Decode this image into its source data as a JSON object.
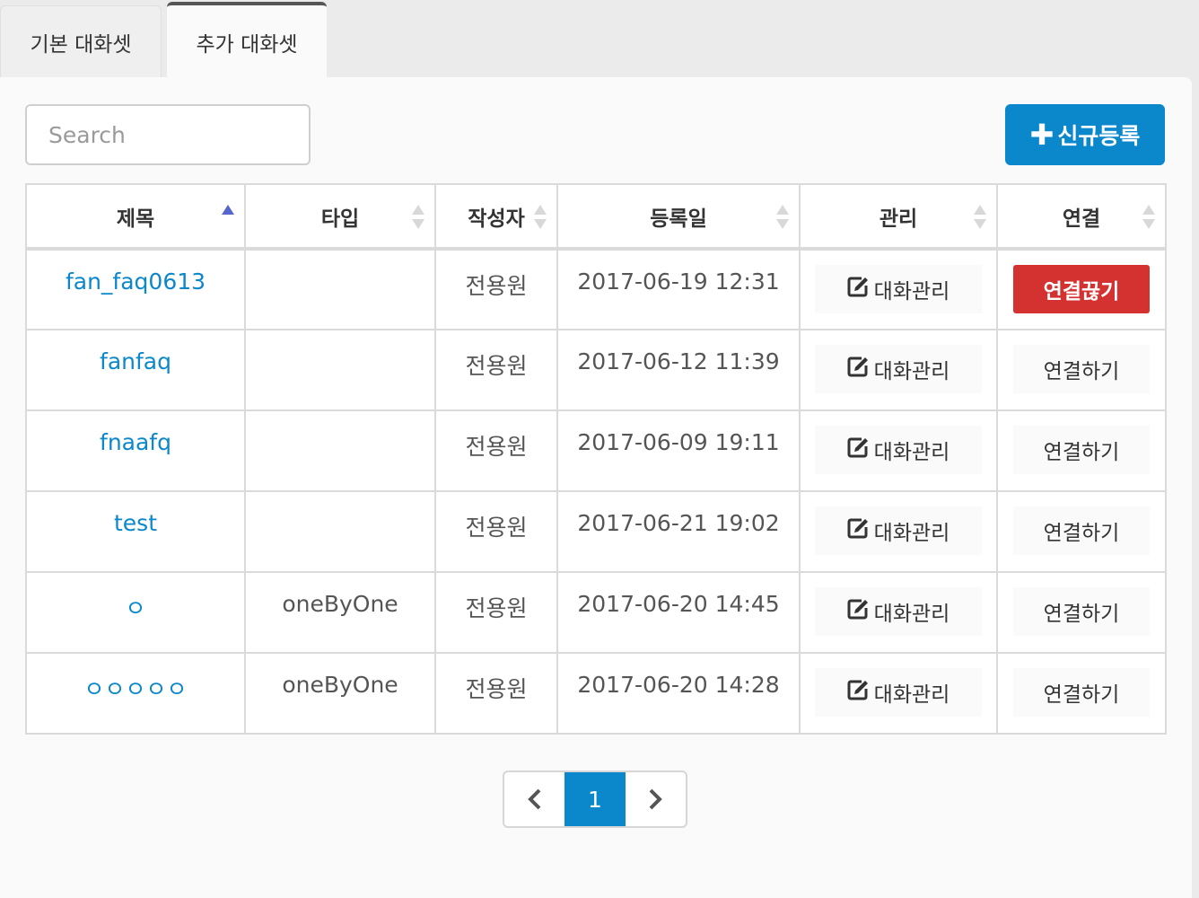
{
  "tabs": [
    {
      "label": "기본 대화셋",
      "active": false
    },
    {
      "label": "추가 대화셋",
      "active": true
    }
  ],
  "search": {
    "placeholder": "Search",
    "value": ""
  },
  "new_button": {
    "label": "신규등록",
    "icon": "plus-icon"
  },
  "table": {
    "columns": [
      "제목",
      "타입",
      "작성자",
      "등록일",
      "관리",
      "연결"
    ],
    "sort": {
      "column": "제목",
      "direction": "asc"
    },
    "rows": [
      {
        "title": "fan_faq0613",
        "type": "",
        "author": "전용원",
        "date": "2017-06-19 12:31",
        "manage": "대화관리",
        "connect": "연결끊기",
        "connected": true
      },
      {
        "title": "fanfaq",
        "type": "",
        "author": "전용원",
        "date": "2017-06-12 11:39",
        "manage": "대화관리",
        "connect": "연결하기",
        "connected": false
      },
      {
        "title": "fnaafq",
        "type": "",
        "author": "전용원",
        "date": "2017-06-09 19:11",
        "manage": "대화관리",
        "connect": "연결하기",
        "connected": false
      },
      {
        "title": "test",
        "type": "",
        "author": "전용원",
        "date": "2017-06-21 19:02",
        "manage": "대화관리",
        "connect": "연결하기",
        "connected": false
      },
      {
        "title": "ㅇ",
        "type": "oneByOne",
        "author": "전용원",
        "date": "2017-06-20 14:45",
        "manage": "대화관리",
        "connect": "연결하기",
        "connected": false
      },
      {
        "title": "ㅇㅇㅇㅇㅇ",
        "type": "oneByOne",
        "author": "전용원",
        "date": "2017-06-20 14:28",
        "manage": "대화관리",
        "connect": "연결하기",
        "connected": false
      }
    ]
  },
  "pagination": {
    "prev_icon": "chevron-left-icon",
    "current": "1",
    "next_icon": "chevron-right-icon"
  },
  "colors": {
    "primary": "#0b87cc",
    "danger": "#d33231",
    "sort_active": "#5566cc"
  }
}
